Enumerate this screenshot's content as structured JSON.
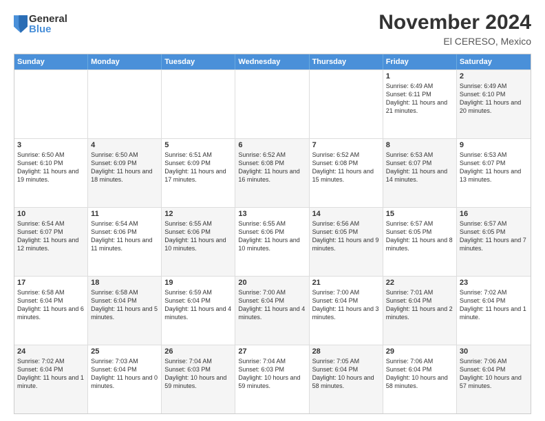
{
  "logo": {
    "general": "General",
    "blue": "Blue"
  },
  "header": {
    "month": "November 2024",
    "location": "El CERESO, Mexico"
  },
  "weekdays": [
    "Sunday",
    "Monday",
    "Tuesday",
    "Wednesday",
    "Thursday",
    "Friday",
    "Saturday"
  ],
  "rows": [
    [
      {
        "day": "",
        "text": "",
        "empty": true
      },
      {
        "day": "",
        "text": "",
        "empty": true
      },
      {
        "day": "",
        "text": "",
        "empty": true
      },
      {
        "day": "",
        "text": "",
        "empty": true
      },
      {
        "day": "",
        "text": "",
        "empty": true
      },
      {
        "day": "1",
        "text": "Sunrise: 6:49 AM\nSunset: 6:11 PM\nDaylight: 11 hours\nand 21 minutes.",
        "empty": false
      },
      {
        "day": "2",
        "text": "Sunrise: 6:49 AM\nSunset: 6:10 PM\nDaylight: 11 hours\nand 20 minutes.",
        "empty": false,
        "shaded": true
      }
    ],
    [
      {
        "day": "3",
        "text": "Sunrise: 6:50 AM\nSunset: 6:10 PM\nDaylight: 11 hours\nand 19 minutes.",
        "empty": false
      },
      {
        "day": "4",
        "text": "Sunrise: 6:50 AM\nSunset: 6:09 PM\nDaylight: 11 hours\nand 18 minutes.",
        "empty": false,
        "shaded": true
      },
      {
        "day": "5",
        "text": "Sunrise: 6:51 AM\nSunset: 6:09 PM\nDaylight: 11 hours\nand 17 minutes.",
        "empty": false
      },
      {
        "day": "6",
        "text": "Sunrise: 6:52 AM\nSunset: 6:08 PM\nDaylight: 11 hours\nand 16 minutes.",
        "empty": false,
        "shaded": true
      },
      {
        "day": "7",
        "text": "Sunrise: 6:52 AM\nSunset: 6:08 PM\nDaylight: 11 hours\nand 15 minutes.",
        "empty": false
      },
      {
        "day": "8",
        "text": "Sunrise: 6:53 AM\nSunset: 6:07 PM\nDaylight: 11 hours\nand 14 minutes.",
        "empty": false,
        "shaded": true
      },
      {
        "day": "9",
        "text": "Sunrise: 6:53 AM\nSunset: 6:07 PM\nDaylight: 11 hours\nand 13 minutes.",
        "empty": false
      }
    ],
    [
      {
        "day": "10",
        "text": "Sunrise: 6:54 AM\nSunset: 6:07 PM\nDaylight: 11 hours\nand 12 minutes.",
        "empty": false,
        "shaded": true
      },
      {
        "day": "11",
        "text": "Sunrise: 6:54 AM\nSunset: 6:06 PM\nDaylight: 11 hours\nand 11 minutes.",
        "empty": false
      },
      {
        "day": "12",
        "text": "Sunrise: 6:55 AM\nSunset: 6:06 PM\nDaylight: 11 hours\nand 10 minutes.",
        "empty": false,
        "shaded": true
      },
      {
        "day": "13",
        "text": "Sunrise: 6:55 AM\nSunset: 6:06 PM\nDaylight: 11 hours\nand 10 minutes.",
        "empty": false
      },
      {
        "day": "14",
        "text": "Sunrise: 6:56 AM\nSunset: 6:05 PM\nDaylight: 11 hours\nand 9 minutes.",
        "empty": false,
        "shaded": true
      },
      {
        "day": "15",
        "text": "Sunrise: 6:57 AM\nSunset: 6:05 PM\nDaylight: 11 hours\nand 8 minutes.",
        "empty": false
      },
      {
        "day": "16",
        "text": "Sunrise: 6:57 AM\nSunset: 6:05 PM\nDaylight: 11 hours\nand 7 minutes.",
        "empty": false,
        "shaded": true
      }
    ],
    [
      {
        "day": "17",
        "text": "Sunrise: 6:58 AM\nSunset: 6:04 PM\nDaylight: 11 hours\nand 6 minutes.",
        "empty": false
      },
      {
        "day": "18",
        "text": "Sunrise: 6:58 AM\nSunset: 6:04 PM\nDaylight: 11 hours\nand 5 minutes.",
        "empty": false,
        "shaded": true
      },
      {
        "day": "19",
        "text": "Sunrise: 6:59 AM\nSunset: 6:04 PM\nDaylight: 11 hours\nand 4 minutes.",
        "empty": false
      },
      {
        "day": "20",
        "text": "Sunrise: 7:00 AM\nSunset: 6:04 PM\nDaylight: 11 hours\nand 4 minutes.",
        "empty": false,
        "shaded": true
      },
      {
        "day": "21",
        "text": "Sunrise: 7:00 AM\nSunset: 6:04 PM\nDaylight: 11 hours\nand 3 minutes.",
        "empty": false
      },
      {
        "day": "22",
        "text": "Sunrise: 7:01 AM\nSunset: 6:04 PM\nDaylight: 11 hours\nand 2 minutes.",
        "empty": false,
        "shaded": true
      },
      {
        "day": "23",
        "text": "Sunrise: 7:02 AM\nSunset: 6:04 PM\nDaylight: 11 hours\nand 1 minute.",
        "empty": false
      }
    ],
    [
      {
        "day": "24",
        "text": "Sunrise: 7:02 AM\nSunset: 6:04 PM\nDaylight: 11 hours\nand 1 minute.",
        "empty": false,
        "shaded": true
      },
      {
        "day": "25",
        "text": "Sunrise: 7:03 AM\nSunset: 6:04 PM\nDaylight: 11 hours\nand 0 minutes.",
        "empty": false
      },
      {
        "day": "26",
        "text": "Sunrise: 7:04 AM\nSunset: 6:03 PM\nDaylight: 10 hours\nand 59 minutes.",
        "empty": false,
        "shaded": true
      },
      {
        "day": "27",
        "text": "Sunrise: 7:04 AM\nSunset: 6:03 PM\nDaylight: 10 hours\nand 59 minutes.",
        "empty": false
      },
      {
        "day": "28",
        "text": "Sunrise: 7:05 AM\nSunset: 6:04 PM\nDaylight: 10 hours\nand 58 minutes.",
        "empty": false,
        "shaded": true
      },
      {
        "day": "29",
        "text": "Sunrise: 7:06 AM\nSunset: 6:04 PM\nDaylight: 10 hours\nand 58 minutes.",
        "empty": false
      },
      {
        "day": "30",
        "text": "Sunrise: 7:06 AM\nSunset: 6:04 PM\nDaylight: 10 hours\nand 57 minutes.",
        "empty": false,
        "shaded": true
      }
    ]
  ]
}
